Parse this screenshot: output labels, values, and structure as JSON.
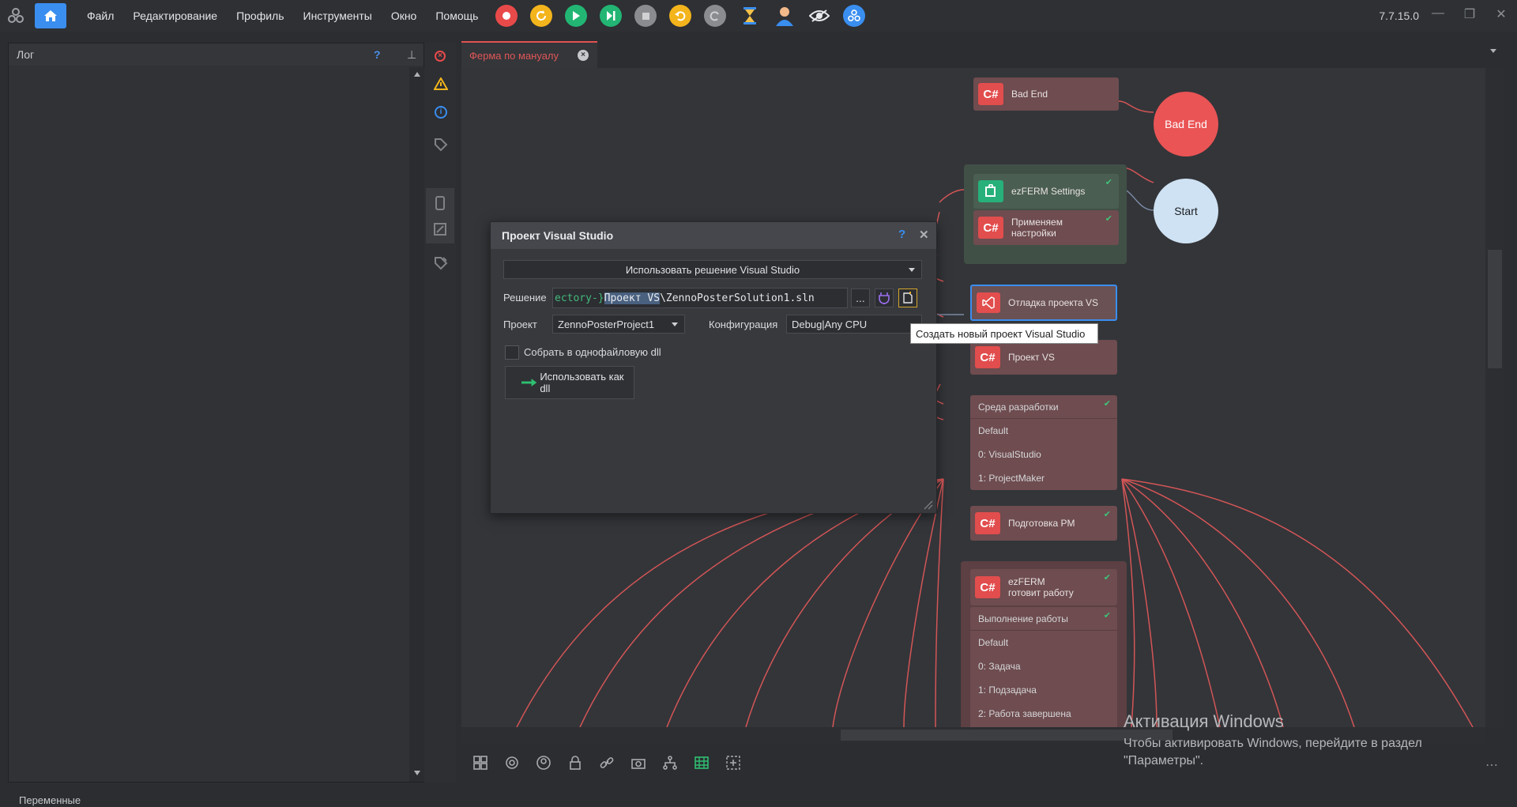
{
  "menu": {
    "items": [
      "Файл",
      "Редактирование",
      "Профиль",
      "Инструменты",
      "Окно",
      "Помощь"
    ]
  },
  "toolbar": {
    "icons": [
      "record-icon",
      "refresh-icon",
      "play-icon",
      "step-icon",
      "stop-icon",
      "undo-icon",
      "redo-icon",
      "hourglass-icon",
      "user-icon",
      "eye-icon",
      "network-icon"
    ]
  },
  "version": "7.7.15.0",
  "log": {
    "title": "Лог",
    "help": "?"
  },
  "tab": {
    "label": "Ферма по мануалу"
  },
  "nodes": {
    "bad_end_action": "Bad End",
    "bad_end_circle": "Bad End",
    "start": "Start",
    "ezferm_settings": "ezFERM Settings",
    "apply_settings": "Применяем настройки",
    "debug_vs": "Отладка проекта VS",
    "project_vs": "Проект VS",
    "switch_title": "Среда разработки",
    "switch_default": "Default",
    "switch_0": "0: VisualStudio",
    "switch_1": "1: ProjectMaker",
    "prepare_pm": "Подготовка PM",
    "ezferm_work": "ezFERM готовит работу",
    "work_title": "Выполнение работы",
    "work_default": "Default",
    "work_0": "0: Задача",
    "work_1": "1: Подзадача",
    "work_2": "2: Работа завершена"
  },
  "dialog": {
    "title": "Проект Visual Studio",
    "help": "?",
    "mode": "Использовать решение Visual Studio",
    "solution_label": "Решение",
    "solution_prefix": "ectory-}",
    "solution_selected": "Проект VS",
    "solution_suffix": "\\ZennoPosterSolution1.sln",
    "browse": "...",
    "project_label": "Проект",
    "project_value": "ZennoPosterProject1",
    "config_label": "Конфигурация",
    "config_value": "Debug|Any CPU",
    "single_dll": "Собрать в однофайловую dll",
    "use_as_dll": "Использовать как dll"
  },
  "tooltip": "Создать новый проект Visual Studio",
  "watermark": {
    "title": "Активация Windows",
    "line1": "Чтобы активировать Windows, перейдите в раздел",
    "line2": "\"Параметры\"."
  },
  "status": {
    "variables": "Переменные"
  },
  "colors": {
    "accent": "#3a8ef0",
    "node": "#6e4c4f",
    "cs_badge": "#e24d4d",
    "vs_badge": "#e24d4d",
    "link": "#e05a5a",
    "start": "#cfe2f3",
    "bad_end": "#ea5455",
    "check": "#3fc27a"
  }
}
